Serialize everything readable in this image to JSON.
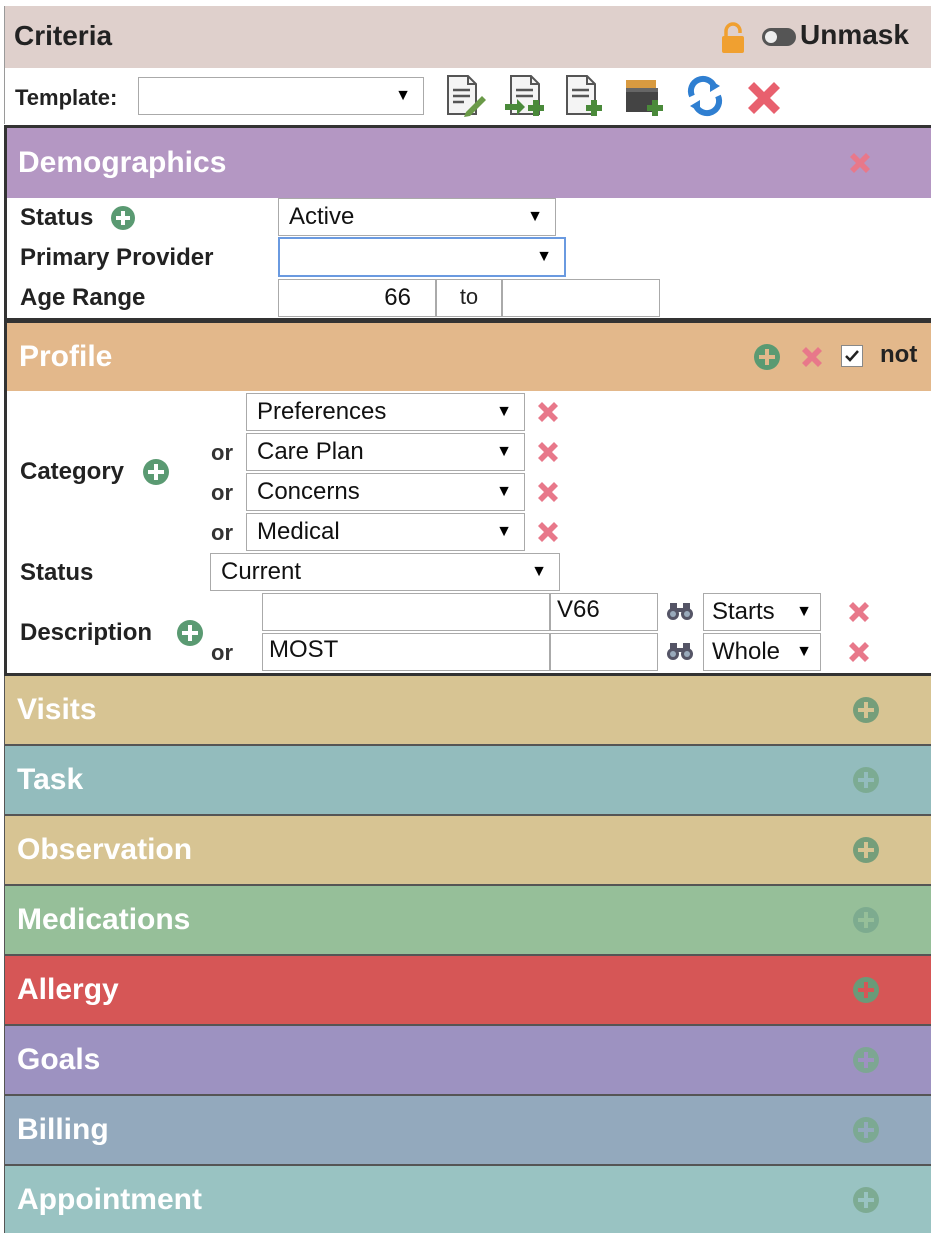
{
  "header": {
    "title": "Criteria",
    "unmask_label": "Unmask"
  },
  "template": {
    "label": "Template:",
    "value": "",
    "toolbar_icons": [
      "edit-document-icon",
      "import-document-icon",
      "add-document-icon",
      "add-folder-icon",
      "refresh-icon",
      "delete-icon"
    ]
  },
  "demographics": {
    "title": "Demographics",
    "status_label": "Status",
    "status_value": "Active",
    "provider_label": "Primary Provider",
    "provider_value": "",
    "age_label": "Age Range",
    "age_from": "66",
    "age_to_label": "to",
    "age_to": ""
  },
  "profile": {
    "title": "Profile",
    "not_label": "not",
    "not_checked": true,
    "category_label": "Category",
    "or_label": "or",
    "categories": [
      "Preferences",
      "Care Plan",
      "Concerns",
      "Medical"
    ],
    "status_label": "Status",
    "status_value": "Current",
    "description_label": "Description",
    "descriptions": [
      {
        "text": "",
        "code": "V66",
        "match": "Starts"
      },
      {
        "text": "MOST",
        "code": "",
        "match": "Whole"
      }
    ]
  },
  "sections": [
    {
      "title": "Visits",
      "color": "#d7c493"
    },
    {
      "title": "Task",
      "color": "#93bcbd"
    },
    {
      "title": "Observation",
      "color": "#d7c493"
    },
    {
      "title": "Medications",
      "color": "#96bf99"
    },
    {
      "title": "Allergy",
      "color": "#d65656"
    },
    {
      "title": "Goals",
      "color": "#9d92c1"
    },
    {
      "title": "Billing",
      "color": "#93a9bd"
    },
    {
      "title": "Appointment",
      "color": "#99c3c2"
    }
  ],
  "colors": {
    "green_plus": "#5a9a72",
    "red_x": "#e8788a",
    "refresh_blue": "#2f7fd1",
    "lock_orange": "#f0a030"
  }
}
